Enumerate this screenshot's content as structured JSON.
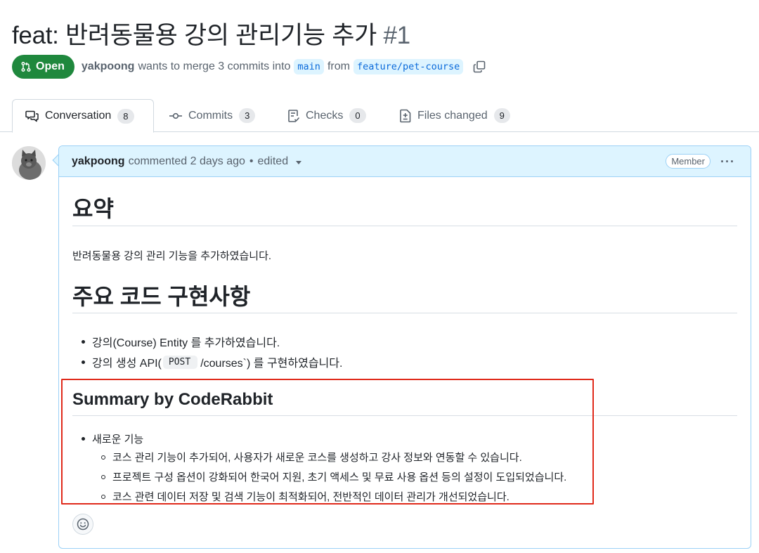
{
  "pr": {
    "title": "feat: 반려동물용 강의 관리기능 추가",
    "number": "#1",
    "state_label": "Open",
    "author": "yakpoong",
    "merge_text": "wants to merge 3 commits into",
    "base_branch": "main",
    "from_text": "from",
    "head_branch": "feature/pet-course"
  },
  "tabs": [
    {
      "label": "Conversation",
      "count": "8",
      "icon": "comment-discussion-icon"
    },
    {
      "label": "Commits",
      "count": "3",
      "icon": "git-commit-icon"
    },
    {
      "label": "Checks",
      "count": "0",
      "icon": "checklist-icon"
    },
    {
      "label": "Files changed",
      "count": "9",
      "icon": "file-diff-icon"
    }
  ],
  "comment": {
    "author": "yakpoong",
    "action": "commented 2 days ago",
    "edited": "edited",
    "role_badge": "Member",
    "menu": "···",
    "summary_heading": "요약",
    "summary_text": "반려동물용 강의 관리 기능을 추가하였습니다.",
    "impl_heading": "주요 코드 구현사항",
    "impl_items": [
      {
        "before": "강의(Course) Entity 를 추가하였습니다.",
        "code": "",
        "after": ""
      },
      {
        "before": "강의 생성 API(",
        "code": "POST",
        "after": "/courses`) 를 구현하였습니다."
      }
    ],
    "coderabbit_heading": "Summary by CodeRabbit",
    "coderabbit_group": "새로운 기능",
    "coderabbit_items": [
      "코스 관리 기능이 추가되어, 사용자가 새로운 코스를 생성하고 강사 정보와 연동할 수 있습니다.",
      "프로젝트 구성 옵션이 강화되어 한국어 지원, 초기 액세스 및 무료 사용 옵션 등의 설정이 도입되었습니다.",
      "코스 관련 데이터 저장 및 검색 기능이 최적화되어, 전반적인 데이터 관리가 개선되었습니다."
    ]
  },
  "colors": {
    "open_green": "#1f883d",
    "link_blue": "#0969da",
    "header_bg": "#ddf4ff",
    "highlight_red": "#e02a1b"
  }
}
